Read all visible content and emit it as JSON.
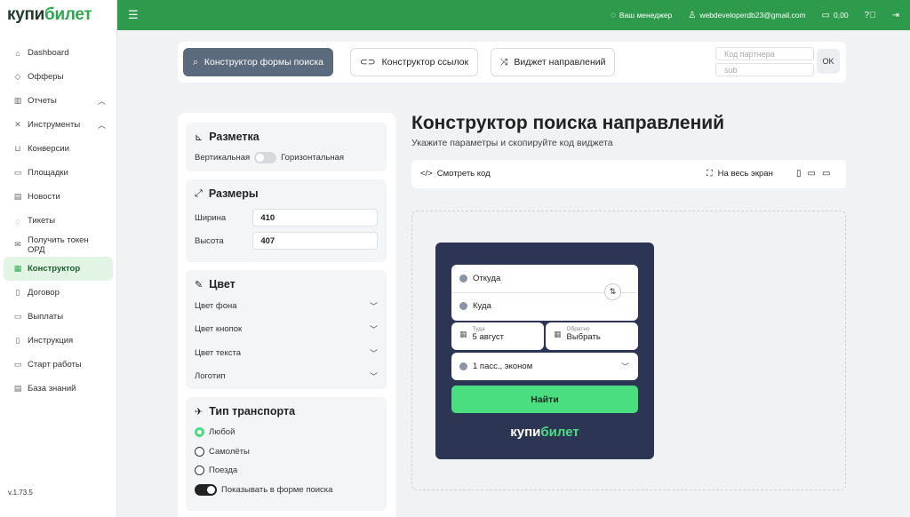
{
  "brand": {
    "logo_main": "купи",
    "logo_accent": "билет"
  },
  "sidebar": {
    "items": [
      {
        "label": "Dashboard",
        "icon": "home-icon"
      },
      {
        "label": "Офферы",
        "icon": "tag-icon"
      },
      {
        "label": "Отчеты",
        "icon": "bar-chart-icon",
        "expandable": true
      },
      {
        "label": "Инструменты",
        "icon": "tools-icon",
        "expandable": true
      },
      {
        "label": "Конверсии",
        "icon": "cart-icon"
      },
      {
        "label": "Площадки",
        "icon": "window-icon"
      },
      {
        "label": "Новости",
        "icon": "newspaper-icon"
      },
      {
        "label": "Тикеты",
        "icon": "chat-icon"
      },
      {
        "label": "Получить токен ОРД",
        "icon": "mail-icon"
      },
      {
        "label": "Конструктор",
        "icon": "builder-icon",
        "active": true
      },
      {
        "label": "Договор",
        "icon": "book-icon"
      },
      {
        "label": "Выплаты",
        "icon": "card-icon"
      },
      {
        "label": "Инструкция",
        "icon": "book-open-icon"
      },
      {
        "label": "Старт работы",
        "icon": "monitor-icon"
      },
      {
        "label": "База знаний",
        "icon": "database-icon"
      }
    ],
    "version": "v.1.73.5"
  },
  "topbar": {
    "manager": "Ваш менеджер",
    "email": "webdeveloperdb23@gmail.com",
    "balance": "0,00",
    "accent_color": "#2e9b4c"
  },
  "toolbar": {
    "tabs": [
      {
        "label": "Конструктор формы поиска",
        "icon": "search-icon",
        "active": true
      },
      {
        "label": "Конструктор ссылок",
        "icon": "link-icon"
      },
      {
        "label": "Виджет направлений",
        "icon": "shuffle-icon"
      }
    ],
    "partner_code_placeholder": "Код партнера",
    "sub_placeholder": "sub",
    "ok_label": "OK"
  },
  "settings": {
    "markup": {
      "title": "Разметка",
      "vertical": "Вертикальная",
      "horizontal": "Горизонтальная"
    },
    "sizes": {
      "title": "Размеры",
      "width_label": "Ширина",
      "width_value": "410",
      "height_label": "Высота",
      "height_value": "407"
    },
    "color": {
      "title": "Цвет",
      "rows": [
        "Цвет фона",
        "Цвет кнопок",
        "Цвет текста",
        "Логотип"
      ]
    },
    "transport": {
      "title": "Тип транспорта",
      "options": [
        "Любой",
        "Самолёты",
        "Поезда"
      ],
      "selected": "Любой",
      "show_in_form": "Показывать в форме поиска"
    }
  },
  "main": {
    "title": "Конструктор поиска направлений",
    "subtitle": "Укажите параметры и скопируйте код виджета",
    "view_code": "Смотреть код",
    "fullscreen": "На весь экран"
  },
  "widget": {
    "from": "Откуда",
    "to": "Куда",
    "there_small": "Туда",
    "there_value": "5 август",
    "back_small": "Обратно",
    "back_value": "Выбрать",
    "passengers": "1 пасс., эконом",
    "find": "Найти",
    "logo_main": "купи",
    "logo_accent": "билет",
    "bg_color": "#2c3654",
    "button_color": "#4ade80"
  }
}
